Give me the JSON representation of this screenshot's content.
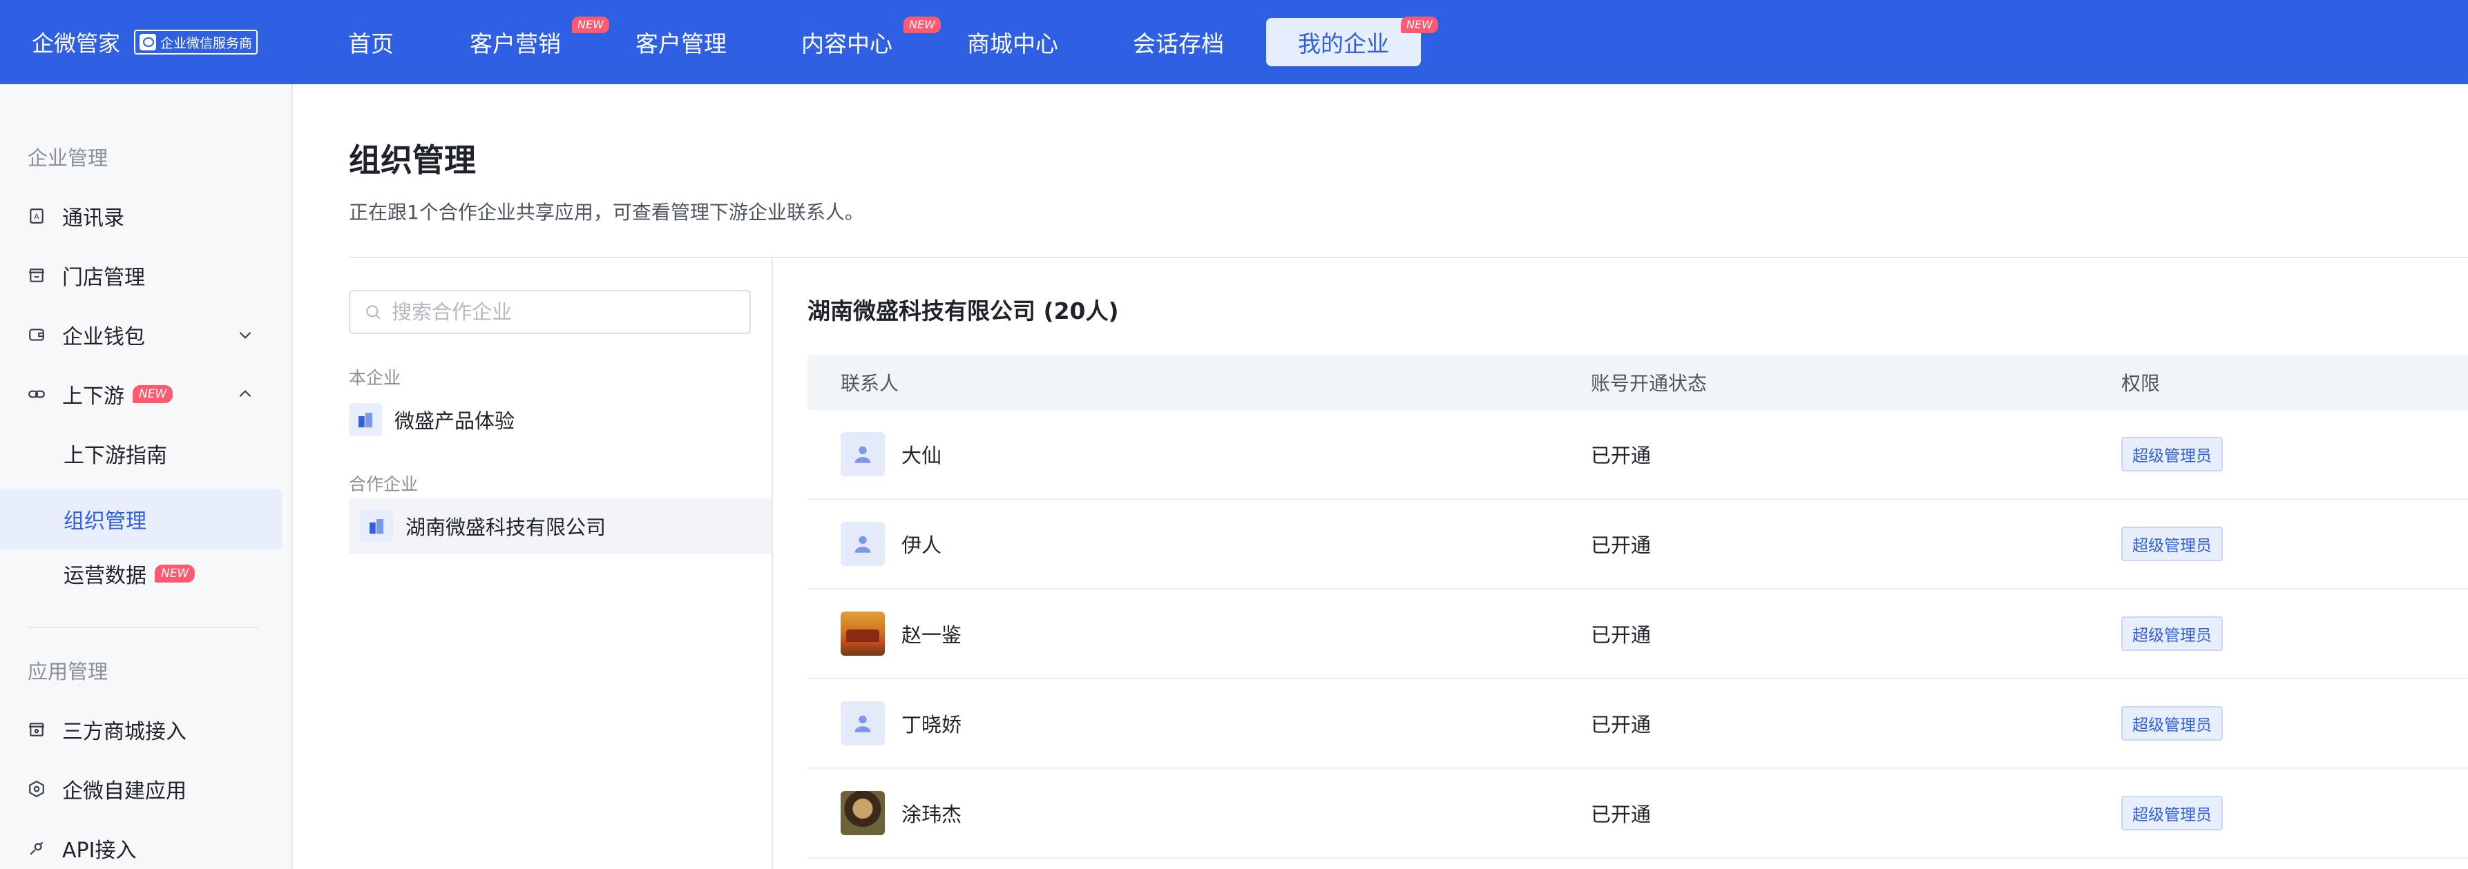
{
  "header": {
    "brand": "企微管家",
    "badge": "企业微信服务商",
    "nav": [
      {
        "label": "首页",
        "new": false,
        "active": false
      },
      {
        "label": "客户营销",
        "new": true,
        "active": false
      },
      {
        "label": "客户管理",
        "new": false,
        "active": false
      },
      {
        "label": "内容中心",
        "new": true,
        "active": false
      },
      {
        "label": "商城中心",
        "new": false,
        "active": false
      },
      {
        "label": "会话存档",
        "new": false,
        "active": false
      },
      {
        "label": "我的企业",
        "new": true,
        "active": true
      }
    ],
    "new_tag": "NEW"
  },
  "sidebar": {
    "group_enterprise": "企业管理",
    "group_app": "应用管理",
    "items": [
      {
        "label": "通讯录",
        "icon": "contacts-icon"
      },
      {
        "label": "门店管理",
        "icon": "store-icon"
      },
      {
        "label": "企业钱包",
        "icon": "wallet-icon"
      },
      {
        "label": "上下游",
        "icon": "link-icon"
      },
      {
        "label": "上下游指南"
      },
      {
        "label": "组织管理"
      },
      {
        "label": "运营数据"
      },
      {
        "label": "三方商城接入",
        "icon": "mall-icon"
      },
      {
        "label": "企微自建应用",
        "icon": "app-icon"
      },
      {
        "label": "API接入",
        "icon": "api-icon"
      }
    ],
    "new_tag": "NEW"
  },
  "main": {
    "title": "组织管理",
    "description": "正在跟1个合作企业共享应用，可查看管理下游企业联系人。",
    "search_placeholder": "搜索合作企业",
    "own_group": "本企业",
    "own_company": "微盛产品体验",
    "partner_group": "合作企业",
    "partner_company": "湖南微盛科技有限公司",
    "company_title": "湖南微盛科技有限公司 (20人)",
    "columns": [
      "联系人",
      "账号开通状态",
      "权限"
    ],
    "rows": [
      {
        "name": "大仙",
        "status": "已开通",
        "role": "超级管理员",
        "avatar": "default"
      },
      {
        "name": "伊人",
        "status": "已开通",
        "role": "超级管理员",
        "avatar": "default"
      },
      {
        "name": "赵一鉴",
        "status": "已开通",
        "role": "超级管理员",
        "avatar": "landscape"
      },
      {
        "name": "丁晓娇",
        "status": "已开通",
        "role": "超级管理员",
        "avatar": "default"
      },
      {
        "name": "涂玮杰",
        "status": "已开通",
        "role": "超级管理员",
        "avatar": "portrait"
      }
    ]
  }
}
